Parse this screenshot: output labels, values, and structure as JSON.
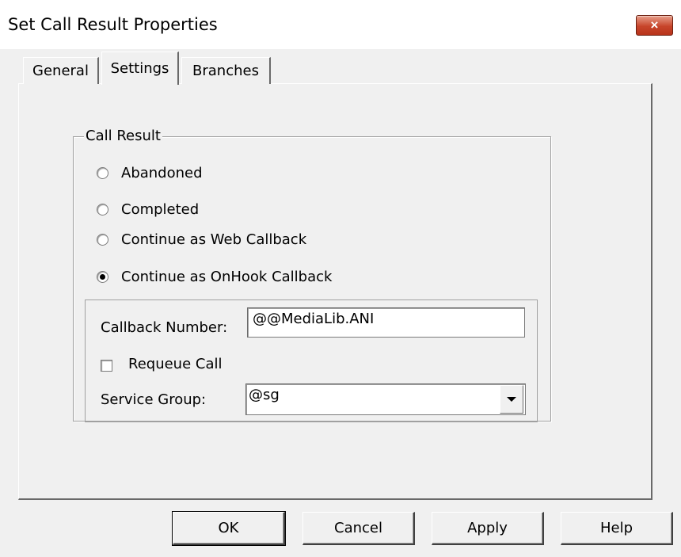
{
  "window": {
    "title": "Set Call Result Properties",
    "close_icon": "×"
  },
  "tabs": [
    {
      "label": "General",
      "active": false
    },
    {
      "label": "Settings",
      "active": true
    },
    {
      "label": "Branches",
      "active": false
    }
  ],
  "call_result": {
    "legend": "Call Result",
    "options": [
      {
        "label": "Abandoned",
        "checked": false
      },
      {
        "label": "Completed",
        "checked": false
      },
      {
        "label": "Continue as Web Callback",
        "checked": false
      },
      {
        "label": "Continue as OnHook Callback",
        "checked": true
      }
    ]
  },
  "callback": {
    "number_label": "Callback Number:",
    "number_value": "@@MediaLib.ANI",
    "requeue_label": "Requeue Call",
    "requeue_checked": false,
    "service_group_label": "Service Group:",
    "service_group_value": "@sg"
  },
  "buttons": {
    "ok": "OK",
    "cancel": "Cancel",
    "apply": "Apply",
    "help": "Help"
  }
}
